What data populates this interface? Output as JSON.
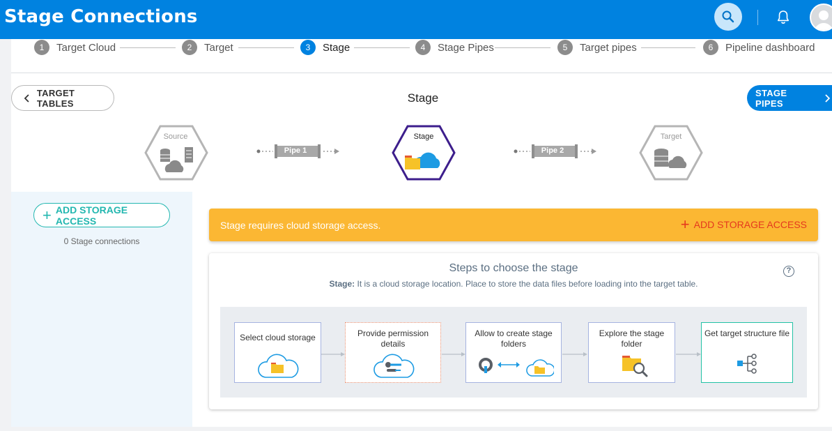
{
  "header": {
    "title": "Stage Connections"
  },
  "stepper": [
    {
      "num": "1",
      "label": "Target Cloud"
    },
    {
      "num": "2",
      "label": "Target"
    },
    {
      "num": "3",
      "label": "Stage"
    },
    {
      "num": "4",
      "label": "Stage Pipes"
    },
    {
      "num": "5",
      "label": "Target pipes"
    },
    {
      "num": "6",
      "label": "Pipeline dashboard"
    }
  ],
  "stepper_active": 3,
  "nav": {
    "back_label": "TARGET TABLES",
    "title": "Stage",
    "next_label": "STAGE PIPES"
  },
  "pipeline": {
    "source_label": "Source",
    "pipe1_label": "Pipe 1",
    "stage_label": "Stage",
    "pipe2_label": "Pipe 2",
    "target_label": "Target"
  },
  "sidebar": {
    "add_label": "ADD STORAGE ACCESS",
    "count_text": "0 Stage connections"
  },
  "alert": {
    "message": "Stage requires cloud storage access.",
    "action_label": "ADD STORAGE ACCESS"
  },
  "steps_card": {
    "title": "Steps to choose the stage",
    "subtitle_bold": "Stage:",
    "subtitle_text": " It is a cloud storage location. Place to store the data files before loading into the target table.",
    "help_glyph": "?",
    "flow": [
      {
        "label": "Select cloud storage"
      },
      {
        "label": "Provide permission details"
      },
      {
        "label": "Allow to create stage folders"
      },
      {
        "label": "Explore the stage folder"
      },
      {
        "label": "Get target structure file"
      }
    ]
  },
  "colors": {
    "primary": "#0082e0",
    "accent_teal": "#23b7b0",
    "warning": "#fbb733",
    "danger": "#e5391e",
    "stage_purple": "#3d1e8c"
  },
  "icons": [
    "search-icon",
    "bell-icon",
    "user-avatar-icon",
    "chevron-left-icon",
    "chevron-right-icon",
    "plus-icon",
    "help-icon",
    "database-icon",
    "cloud-icon",
    "folder-icon",
    "key-icon",
    "sync-icon",
    "magnifier-icon",
    "tree-structure-icon"
  ]
}
